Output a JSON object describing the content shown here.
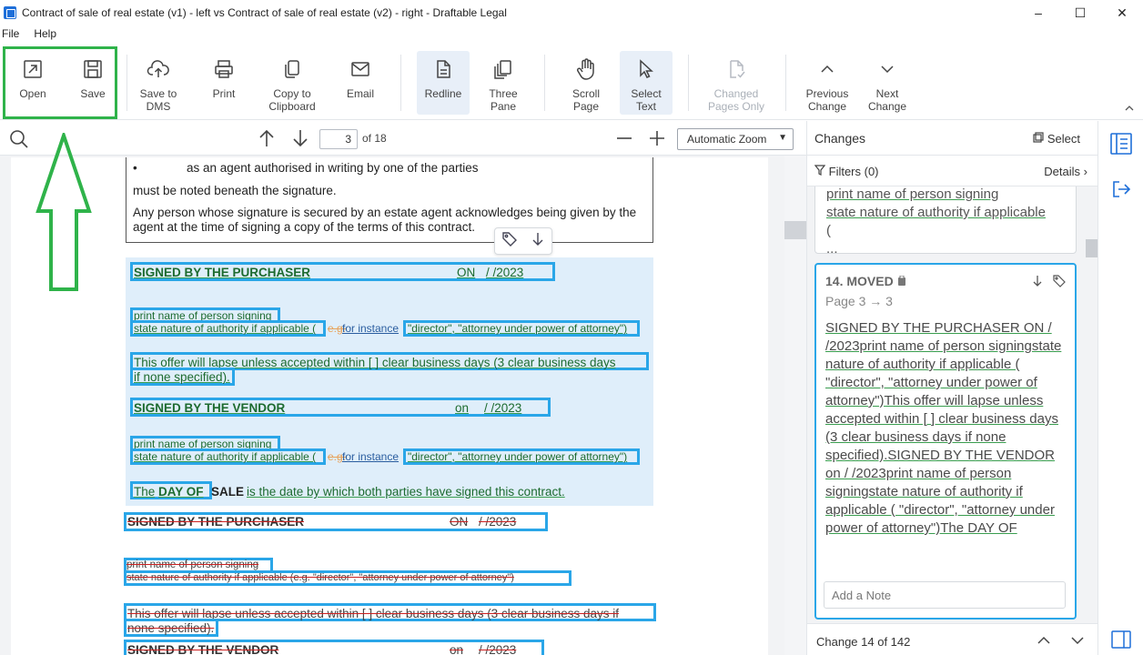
{
  "window": {
    "title": "Contract of sale of real estate (v1) - left vs Contract of sale of real estate (v2) - right - Draftable Legal",
    "minimize": "–",
    "maximize": "☐",
    "close": "✕"
  },
  "menu": {
    "file": "File",
    "help": "Help"
  },
  "toolbar": {
    "open": "Open",
    "save": "Save",
    "save_dms": "Save to\nDMS",
    "print": "Print",
    "copy": "Copy to\nClipboard",
    "email": "Email",
    "redline": "Redline",
    "three_pane": "Three\nPane",
    "scroll_page": "Scroll\nPage",
    "select_text": "Select\nText",
    "changed_pages": "Changed\nPages Only",
    "previous_change": "Previous\nChange",
    "next_change": "Next\nChange"
  },
  "docbar": {
    "page_value": "3",
    "page_of": "of 18",
    "zoom": "Automatic Zoom"
  },
  "document": {
    "bullet": "•",
    "agent_line": "as an agent authorised in writing by one of the parties",
    "noted_line": "must be noted beneath the signature.",
    "estate_agent_line1": "Any person whose signature is secured by an estate agent acknowledges being given by the",
    "estate_agent_line2": "agent at the time of signing a copy of the terms of this contract.",
    "ins_purchaser": "SIGNED BY THE PURCHASER",
    "ins_purchaser_on": "ON",
    "ins_purchaser_date": "/        /2023",
    "ins_print_name": "print name of person signing",
    "ins_state_nature": "state nature of authority if applicable (",
    "ins_eg": "e.g.",
    "ins_for_instance": "for instance",
    "ins_director": "\"director\", \"attorney under power of attorney\")",
    "ins_offer_line1": "This offer will lapse unless accepted within [       ] clear business days (3 clear business days",
    "ins_offer_line2": "if none specified).",
    "ins_vendor": "SIGNED BY THE VENDOR",
    "ins_vendor_on": "on",
    "ins_vendor_date": "/        /2023",
    "ins_day_the": "The",
    "ins_day_of": "DAY OF",
    "ins_sale": "SALE",
    "ins_day_rest": "is the date by which both parties have signed this contract.",
    "del_purchaser": "SIGNED BY THE PURCHASER",
    "del_purchaser_on": "ON",
    "del_purchaser_date": "/        /2023",
    "del_print_name": "print name of person signing",
    "del_state_nature": "state nature of authority if applicable (e.g. \"director\", \"attorney under power of attorney\")",
    "del_offer_line1": "This offer will lapse unless accepted within [       ] clear business days (3 clear business days if",
    "del_offer_line2": "none specified).",
    "del_vendor": "SIGNED BY THE VENDOR",
    "del_vendor_on": "on",
    "del_vendor_date": "/        /2023"
  },
  "changes": {
    "title": "Changes",
    "select": "Select",
    "filters": "Filters (0)",
    "details": "Details",
    "prev_card_line1": "print name of person signing",
    "prev_card_line2": "state nature of authority if applicable",
    "prev_card_line3": "(",
    "prev_card_line4": "...",
    "card_head": "14. MOVED",
    "card_sub": "Page 3 → 3",
    "card_body": "SIGNED BY THE PURCHASER       ON       /       /2023print name of person signingstate nature of authority if applicable ( \"director\", \"attorney under power of attorney\")This offer will lapse unless accepted within [       ] clear business days (3 clear business days if none specified).SIGNED BY THE VENDOR        on       /       /2023print name of person signingstate nature of authority if applicable ( \"director\", \"attorney under power of attorney\")The DAY OF",
    "note_placeholder": "Add a Note",
    "footer": "Change 14 of 142"
  },
  "colors": {
    "accent_blue": "#2aa6e8",
    "highlight_green": "#2fb34a",
    "insert_bg": "#dfeefa",
    "insert_text": "#1d6b2f",
    "delete_strike": "#cc2222"
  }
}
